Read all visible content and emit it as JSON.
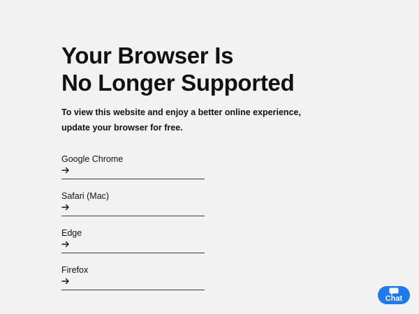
{
  "heading": {
    "line1": "Your Browser Is",
    "line2": "No Longer Supported"
  },
  "subtext": {
    "line1": "To view this website and enjoy a better online experience,",
    "line2": "update your browser for free."
  },
  "browsers": [
    {
      "label": "Google Chrome",
      "icon": "arrow-right-icon"
    },
    {
      "label": "Safari (Mac)",
      "icon": "arrow-right-icon"
    },
    {
      "label": "Edge",
      "icon": "arrow-right-icon"
    },
    {
      "label": "Firefox",
      "icon": "arrow-right-icon"
    }
  ],
  "chat": {
    "label": "Chat",
    "icon": "chat-bubble-icon",
    "color": "#1d7bf2"
  },
  "colors": {
    "background": "#f2f2f2",
    "text": "#111111",
    "divider": "#3a3a3a"
  }
}
